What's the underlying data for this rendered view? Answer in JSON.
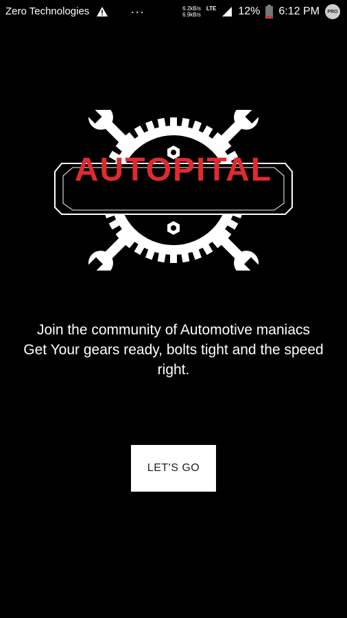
{
  "status_bar": {
    "carrier": "Zero Technologies",
    "more": "···",
    "net_up": "6.2kB/s",
    "net_down": "6.9kB/s",
    "network_type": "LTE",
    "battery_percent": "12%",
    "time": "6:12 PM",
    "badge": "PRO"
  },
  "logo": {
    "brand": "AUTOPITAL",
    "brand_color": "#e02a2f"
  },
  "tagline": {
    "line1": "Join the community of Automotive maniacs",
    "line2": "Get Your gears ready, bolts tight and the speed right."
  },
  "cta": {
    "label": "LET'S GO"
  }
}
